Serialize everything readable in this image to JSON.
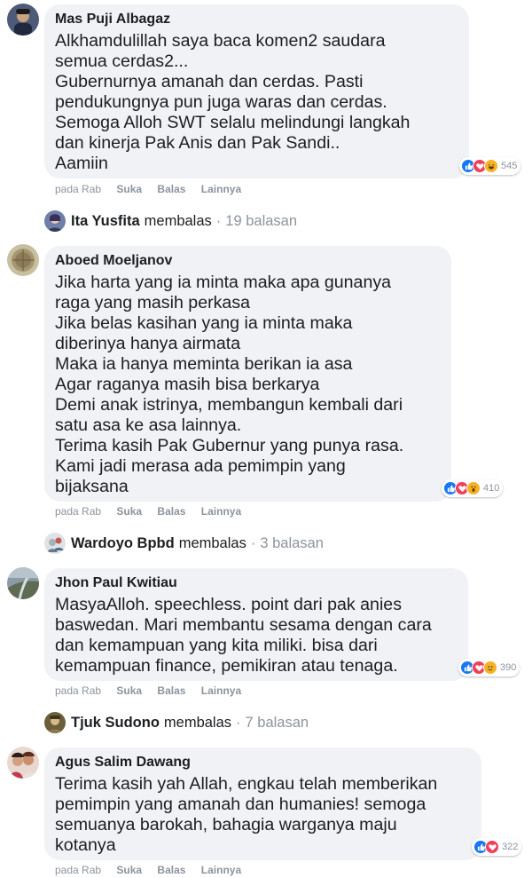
{
  "comments": [
    {
      "author": "Mas Puji Albagaz",
      "text": "Alkhamdulillah saya baca komen2 saudara\nsemua cerdas2...\nGubernurnya amanah dan cerdas. Pasti\npendukungnya pun juga waras dan cerdas.\nSemoga Alloh SWT selalu melindungi langkah\ndan kinerja Pak Anis dan Pak Sandi..\nAamiin",
      "time": "pada Rab",
      "like": "Suka",
      "reply": "Balas",
      "more": "Lainnya",
      "reaction_count": "545",
      "reactions": [
        "like",
        "love",
        "haha"
      ],
      "reply_preview": {
        "name": "Ita Yusfita",
        "verb": "membalas",
        "sep": "·",
        "count": "19 balasan"
      }
    },
    {
      "author": "Aboed Moeljanov",
      "text": "Jika harta yang ia minta maka apa gunanya\nraga yang masih perkasa\nJika belas kasihan yang ia minta maka\ndiberinya hanya airmata\nMaka ia hanya meminta berikan ia asa\nAgar raganya masih bisa berkarya\nDemi anak istrinya, membangun kembali dari\nsatu asa ke asa lainnya.\nTerima kasih Pak Gubernur yang punya rasa.\nKami jadi merasa ada pemimpin yang\nbijaksana",
      "time": "pada Rab",
      "like": "Suka",
      "reply": "Balas",
      "more": "Lainnya",
      "reaction_count": "410",
      "reactions": [
        "like",
        "love",
        "wow"
      ],
      "reply_preview": {
        "name": "Wardoyo Bpbd",
        "verb": "membalas",
        "sep": "·",
        "count": "3 balasan"
      }
    },
    {
      "author": "Jhon Paul Kwitiau",
      "text": "MasyaAlloh. speechless. point dari pak anies\nbaswedan. Mari membantu sesama dengan cara\ndan kemampuan yang kita miliki. bisa dari\nkemampuan finance, pemikiran atau tenaga.",
      "time": "pada Rab",
      "like": "Suka",
      "reply": "Balas",
      "more": "Lainnya",
      "reaction_count": "390",
      "reactions": [
        "like",
        "love",
        "sad"
      ],
      "reply_preview": {
        "name": "Tjuk Sudono",
        "verb": "membalas",
        "sep": "·",
        "count": "7 balasan"
      }
    },
    {
      "author": "Agus Salim Dawang",
      "text": "Terima kasih yah Allah, engkau telah memberikan\npemimpin yang amanah dan humanies! semoga\nsemuanya barokah, bahagia warganya maju\nkotanya",
      "time": "pada Rab",
      "like": "Suka",
      "reply": "Balas",
      "more": "Lainnya",
      "reaction_count": "322",
      "reactions": [
        "like",
        "love"
      ]
    }
  ],
  "colors": {
    "bubble": "#f0f2f5",
    "like": "#1877f2",
    "love": "#f33e58",
    "emoji": "#f7b125",
    "meta": "#8d949e"
  }
}
